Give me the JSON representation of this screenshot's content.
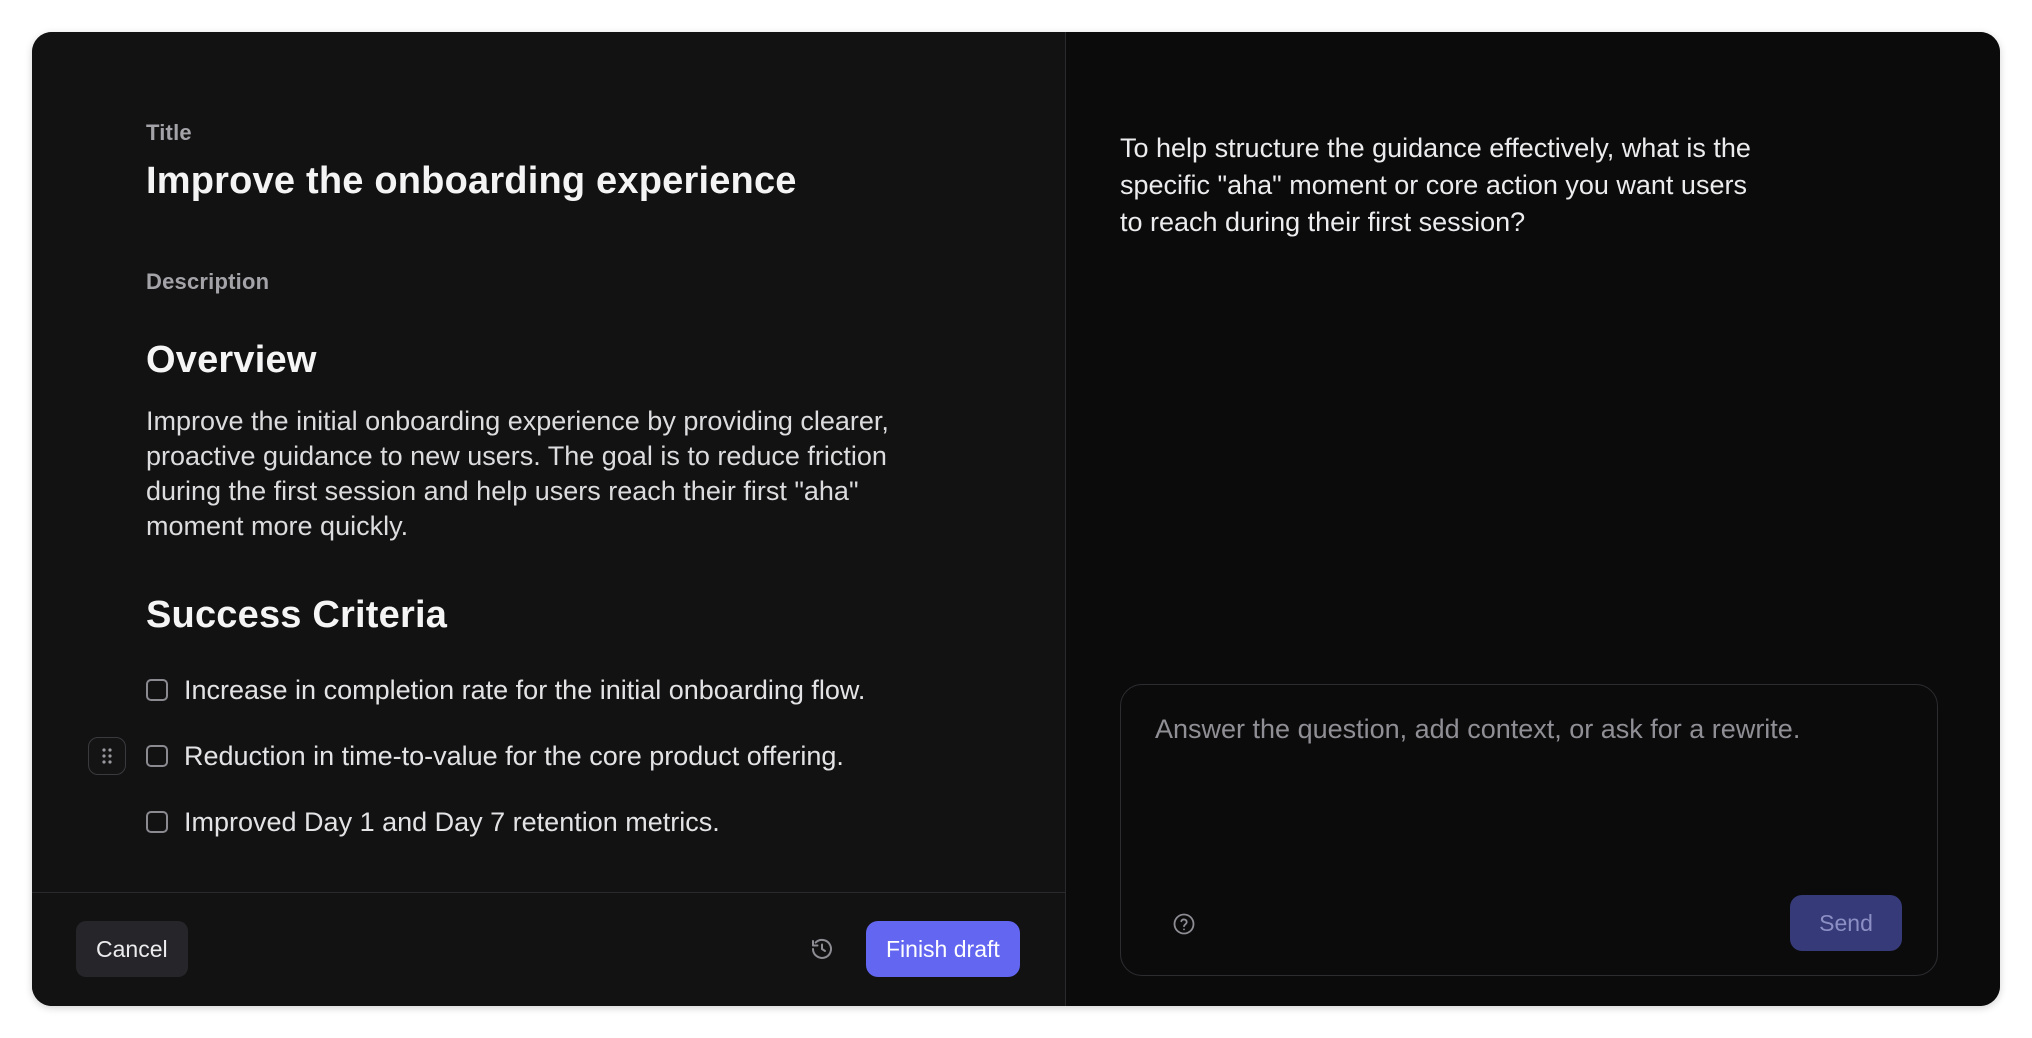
{
  "editor": {
    "title_label": "Title",
    "title_value": "Improve the onboarding experience",
    "description_label": "Description",
    "overview_heading": "Overview",
    "overview_text": "Improve the initial onboarding experience by providing clearer, proactive guidance to new users. The goal is to reduce friction during the first session and help users reach their first \"aha\" moment more quickly.",
    "criteria_heading": "Success Criteria",
    "criteria": [
      {
        "text": "Increase in completion rate for the initial onboarding flow.",
        "checked": false
      },
      {
        "text": "Reduction in time-to-value for the core product offering.",
        "checked": false
      },
      {
        "text": "Improved Day 1 and Day 7 retention metrics.",
        "checked": false
      }
    ]
  },
  "footer": {
    "cancel_label": "Cancel",
    "history_icon": "history-icon",
    "finish_label": "Finish draft"
  },
  "assistant": {
    "message": "To help structure the guidance effectively, what is the specific \"aha\" moment or core action you want users to reach during their first session?",
    "composer_placeholder": "Answer the question, add context, or ask for a rewrite.",
    "help_icon": "help-circle-icon",
    "send_label": "Send"
  },
  "colors": {
    "accent": "#6366f1",
    "send_disabled": "#363a78",
    "background": "#101011"
  }
}
